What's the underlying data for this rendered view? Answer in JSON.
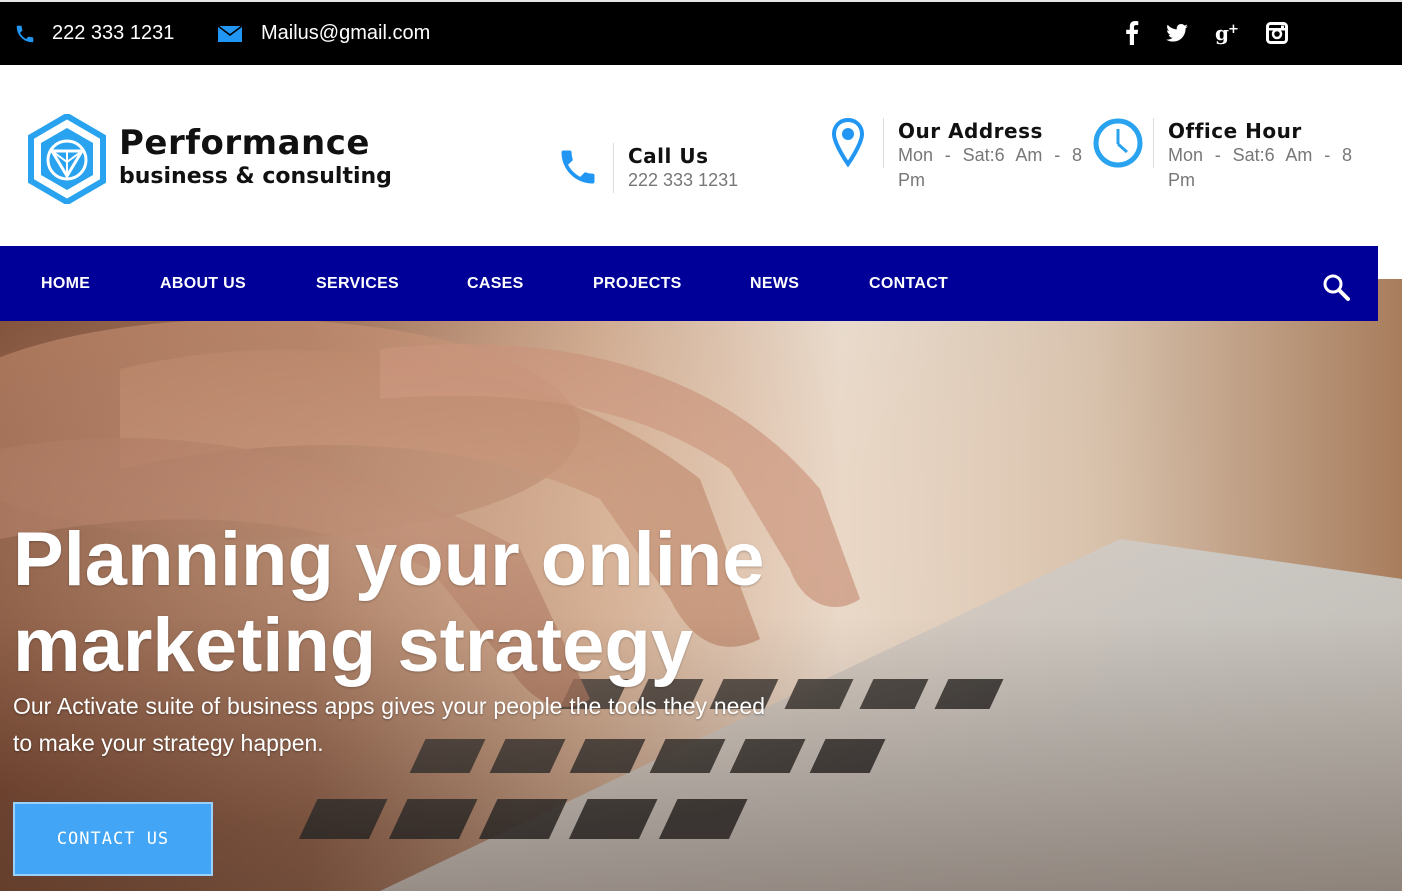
{
  "topbar": {
    "phone": "222 333 1231",
    "email": "Mailus@gmail.com",
    "social": [
      "facebook-icon",
      "twitter-icon",
      "google-plus-icon",
      "instagram-icon"
    ]
  },
  "brand": {
    "title": "Performance",
    "subtitle": "business & consulting"
  },
  "header_info": {
    "call": {
      "title": "Call Us",
      "value": "222 333 1231",
      "icon": "phone-icon"
    },
    "address": {
      "title": "Our Address",
      "value": "Mon - Sat:6 Am - 8 Pm",
      "icon": "map-pin-icon"
    },
    "hours": {
      "title": "Office Hour",
      "value": "Mon - Sat:6 Am - 8 Pm",
      "icon": "clock-icon"
    }
  },
  "nav": {
    "items": [
      "HOME",
      "ABOUT US",
      "SERVICES",
      "CASES",
      "PROJECTS",
      "NEWS",
      "CONTACT"
    ],
    "search_icon": "search-icon"
  },
  "hero": {
    "title": "Planning your online marketing strategy",
    "text": "Our Activate suite of business apps gives your people the tools they need to make your strategy happen.",
    "button": "CONTACT US"
  },
  "colors": {
    "topbar_bg": "#000000",
    "nav_bg": "#000099",
    "accent": "#2196f3",
    "button_bg": "#42a5f5"
  }
}
